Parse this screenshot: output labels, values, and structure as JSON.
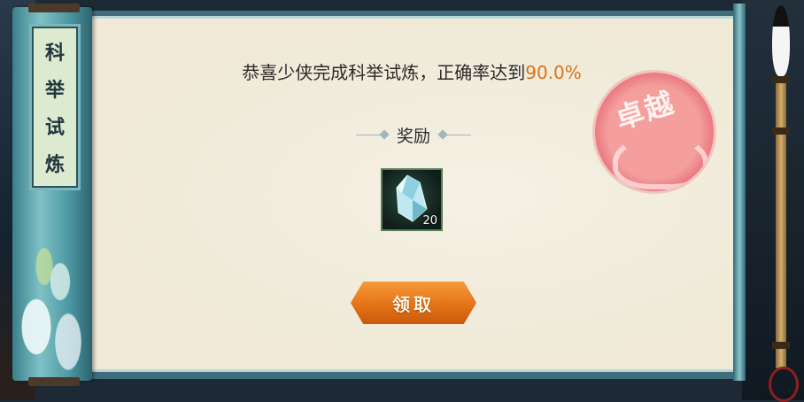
{
  "panel": {
    "title_chars": [
      "科",
      "举",
      "试",
      "炼"
    ]
  },
  "message": {
    "prefix": "恭喜少侠完成科举试炼，正确率达到",
    "percent": "90.0%"
  },
  "reward": {
    "label": "奖励",
    "item_icon": "crystal-icon",
    "item_count": "20"
  },
  "claim_button_label": "领取",
  "seal_text": "卓越",
  "colors": {
    "accent_orange": "#e57316",
    "percent_color": "#d9731b",
    "scroll_teal": "#3f6e7a",
    "seal_red": "#e96e78"
  }
}
